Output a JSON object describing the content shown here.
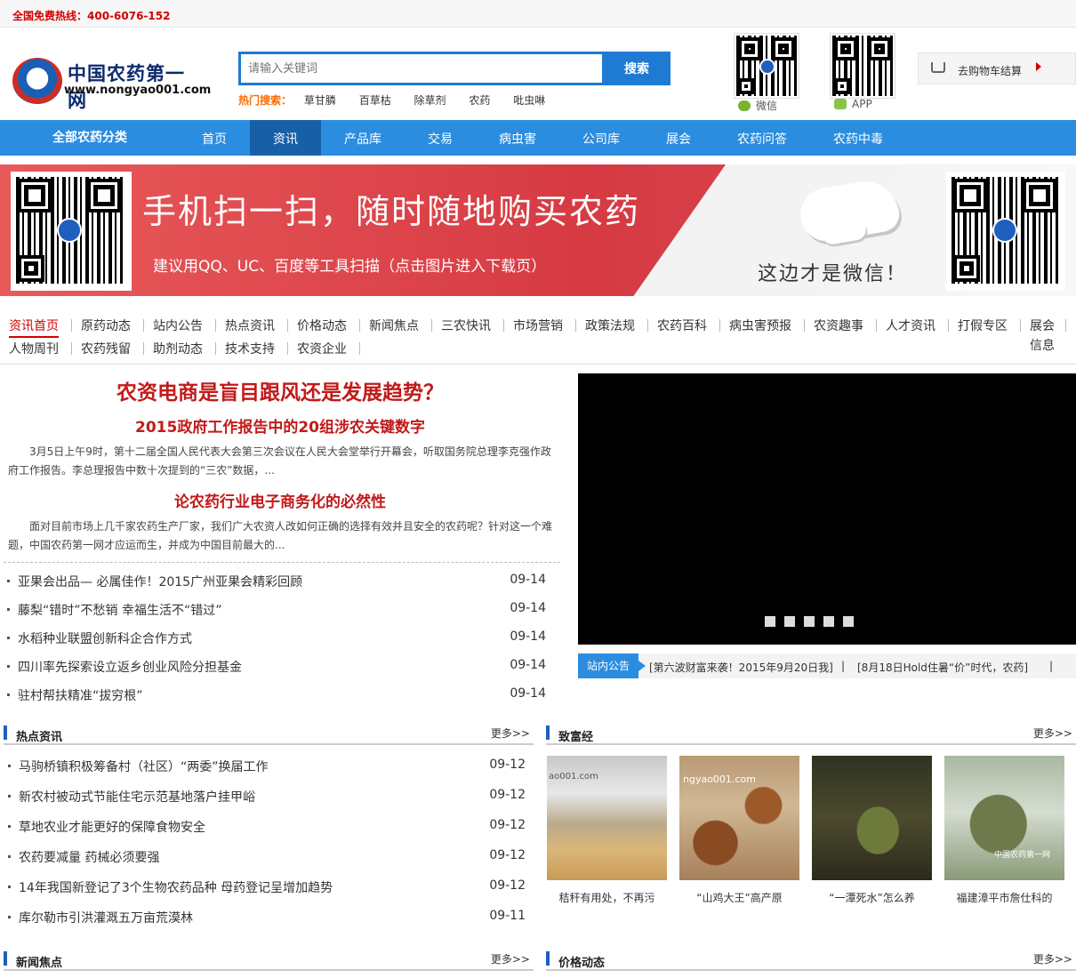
{
  "topbar": {
    "hotline": "全国免费热线：400-6076-152"
  },
  "logo": {
    "name": "中国农药第一网",
    "url": "www.nongyao001.com"
  },
  "search": {
    "placeholder": "请输入关键词",
    "button": "搜索"
  },
  "hot_searches": {
    "label": "热门搜索：",
    "items": [
      "草甘膦",
      "百草枯",
      "除草剂",
      "农药",
      "吡虫啉"
    ]
  },
  "qr_codes": [
    {
      "label": "微信",
      "icon": "wechat-icon"
    },
    {
      "label": "APP",
      "icon": "android-icon"
    }
  ],
  "cart": {
    "label": "去购物车结算"
  },
  "nav": {
    "all_categories": "全部农药分类",
    "items": [
      "首页",
      "资讯",
      "产品库",
      "交易",
      "病虫害",
      "公司库",
      "展会",
      "农药问答",
      "农药中毒"
    ],
    "active_index": 1
  },
  "banner": {
    "headline": "手机扫一扫，随时随地购买农药",
    "subline": "建议用QQ、UC、百度等工具扫描（点击图片进入下载页）",
    "wechat_note": "这边才是微信！"
  },
  "categories": {
    "items": [
      "资讯首页",
      "原药动态",
      "站内公告",
      "热点资讯",
      "价格动态",
      "新闻焦点",
      "三农快讯",
      "市场营销",
      "政策法规",
      "农药百科",
      "病虫害预报",
      "农资趣事",
      "人才资讯",
      "打假专区",
      "展会信息",
      "人物周刊",
      "农药残留",
      "助剂动态",
      "技术支持",
      "农资企业"
    ],
    "active_index": 0
  },
  "headline": {
    "main": "农资电商是盲目跟风还是发展趋势？",
    "sub1": "2015政府工作报告中的20组涉农关键数字",
    "sum1": "3月5日上午9时，第十二届全国人民代表大会第三次会议在人民大会堂举行开幕会，听取国务院总理李克强作政府工作报告。李总理报告中数十次提到的“三农”数据，...",
    "sub2": "论农药行业电子商务化的必然性",
    "sum2": "面对目前市场上几千家农药生产厂家，我们广大农资人改如何正确的选择有效并且安全的农药呢？针对这一个难题，中国农药第一网才应运而生，并成为中国目前最大的..."
  },
  "top_news": [
    {
      "title": "亚果会出品— 必属佳作！2015广州亚果会精彩回顾",
      "date": "09-14"
    },
    {
      "title": "藤梨“错时”不愁销 幸福生活不“错过”",
      "date": "09-14"
    },
    {
      "title": "水稻种业联盟创新科企合作方式",
      "date": "09-14"
    },
    {
      "title": "四川率先探索设立返乡创业风险分担基金",
      "date": "09-14"
    },
    {
      "title": "驻村帮扶精准“拔穷根”",
      "date": "09-14"
    }
  ],
  "notice": {
    "tag": "站内公告",
    "items": [
      "[第六波财富来袭！2015年9月20日我]",
      "[8月18日Hold住暑“价”时代，农药]"
    ],
    "separator": "|"
  },
  "sections": {
    "hot": {
      "title": "热点资讯",
      "more": "更多>>"
    },
    "rich": {
      "title": "致富经",
      "more": "更多>>"
    },
    "focus": {
      "title": "新闻焦点",
      "more": "更多>>"
    },
    "price": {
      "title": "价格动态",
      "more": "更多>>"
    }
  },
  "hot_news": [
    {
      "title": "马驹桥镇积极筹备村（社区）“两委”换届工作",
      "date": "09-12"
    },
    {
      "title": "新农村被动式节能住宅示范基地落户挂甲峪",
      "date": "09-12"
    },
    {
      "title": "草地农业才能更好的保障食物安全",
      "date": "09-12"
    },
    {
      "title": "农药要减量 药械必须要强",
      "date": "09-12"
    },
    {
      "title": "14年我国新登记了3个生物农药品种 母药登记呈增加趋势",
      "date": "09-12"
    },
    {
      "title": "库尔勒市引洪灌溉五万亩荒漠林",
      "date": "09-11"
    }
  ],
  "rich_photos": [
    {
      "caption": "秸秆有用处，不再污",
      "watermark": "ao001.com"
    },
    {
      "caption": "“山鸡大王”高产原",
      "watermark": "ngyao001.com"
    },
    {
      "caption": "“一潭死水”怎么养",
      "watermark": ""
    },
    {
      "caption": "福建漳平市詹仕科的",
      "watermark": "中国农药第一网"
    }
  ]
}
